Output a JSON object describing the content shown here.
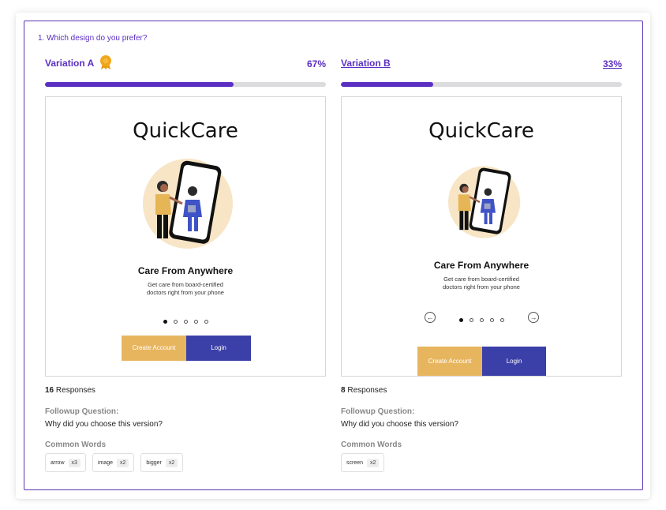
{
  "question": "1. Which design do you prefer?",
  "colors": {
    "accent": "#5b2fc2",
    "frame": "#5b33b5",
    "create_button": "#e8b55f",
    "login_button": "#3b3fa8",
    "bar_track": "#dcdcdf"
  },
  "variations": [
    {
      "title": "Variation A",
      "winner_icon": "award-ribbon-icon",
      "percent_label": "67%",
      "percent_value": 0.67,
      "preview": {
        "logo": "QuickCare",
        "tagline": "Care From Anywhere",
        "description_line1": "Get care from board-certified",
        "description_line2": "doctors right from your phone",
        "carousel_dots": 5,
        "active_dot": 0,
        "create_label": "Create Account",
        "login_label": "Login"
      },
      "responses_count": "16",
      "responses_label": "Responses",
      "followup_label": "Followup Question:",
      "followup_text": "Why did you choose this version?",
      "common_words_label": "Common Words",
      "words": [
        {
          "word": "arrow",
          "count": "x3"
        },
        {
          "word": "image",
          "count": "x2"
        },
        {
          "word": "bigger",
          "count": "x2"
        }
      ]
    },
    {
      "title": "Variation B",
      "percent_label": "33%",
      "percent_value": 0.33,
      "preview": {
        "logo": "QuickCare",
        "tagline": "Care From Anywhere",
        "description_line1": "Get care from board-certified",
        "description_line2": "doctors right from your phone",
        "carousel_dots": 5,
        "active_dot": 0,
        "prev_icon": "arrow-left-circle-icon",
        "next_icon": "arrow-right-circle-icon",
        "create_label": "Create Account",
        "login_label": "Login"
      },
      "responses_count": "8",
      "responses_label": "Responses",
      "followup_label": "Followup Question:",
      "followup_text": "Why did you choose this version?",
      "common_words_label": "Common Words",
      "words": [
        {
          "word": "screen",
          "count": "x2"
        }
      ]
    }
  ]
}
